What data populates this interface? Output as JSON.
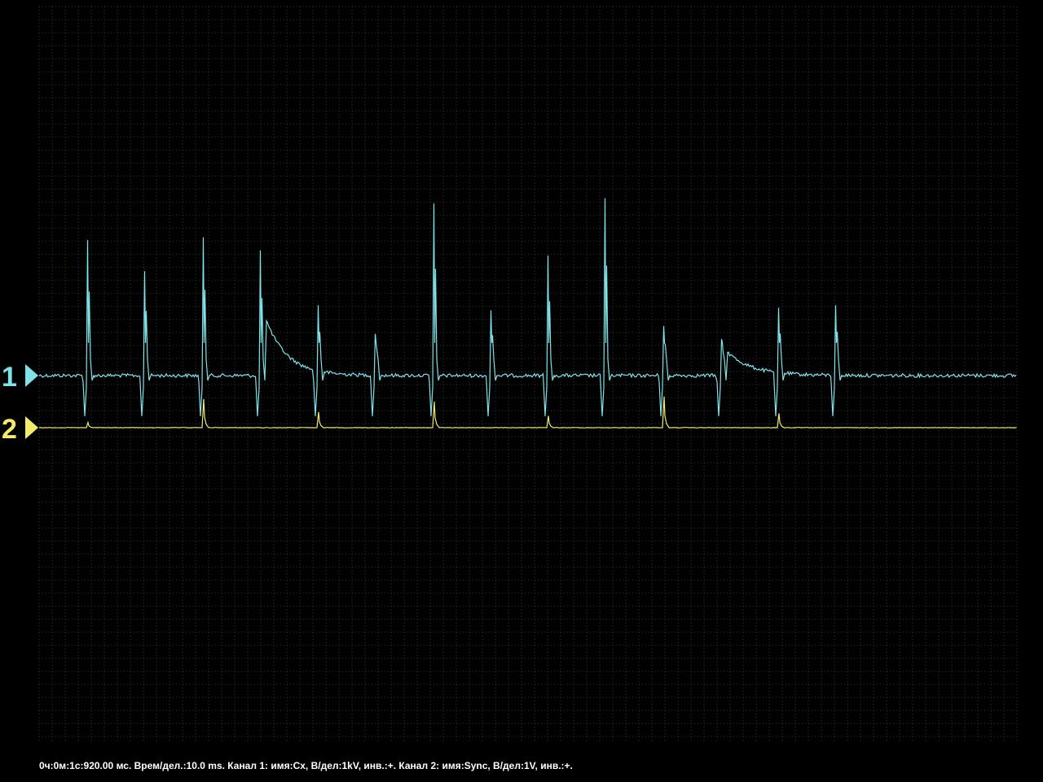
{
  "chart_data": {
    "type": "line",
    "title": "",
    "grid": true,
    "x_unit": "ms",
    "x_range": [
      0,
      120
    ],
    "time_per_div_ms": 10,
    "series": [
      {
        "name": "Cx",
        "marker_label": "1",
        "color": "#7fe3ea",
        "volts_per_div": "1kV",
        "baseline_div": 0,
        "pulses": [
          {
            "t_ms": 6.0,
            "peak_div": 5.2,
            "decay": "none"
          },
          {
            "t_ms": 13.0,
            "peak_div": 4.0,
            "decay": "none"
          },
          {
            "t_ms": 20.2,
            "peak_div": 5.3,
            "decay": "none"
          },
          {
            "t_ms": 27.2,
            "peak_div": 4.8,
            "decay": "long"
          },
          {
            "t_ms": 34.3,
            "peak_div": 2.7,
            "decay": "none"
          },
          {
            "t_ms": 41.3,
            "peak_div": 1.6,
            "decay": "none"
          },
          {
            "t_ms": 48.5,
            "peak_div": 6.6,
            "decay": "none"
          },
          {
            "t_ms": 55.5,
            "peak_div": 2.5,
            "decay": "none"
          },
          {
            "t_ms": 62.5,
            "peak_div": 4.6,
            "decay": "none"
          },
          {
            "t_ms": 69.5,
            "peak_div": 6.8,
            "decay": "none"
          },
          {
            "t_ms": 76.7,
            "peak_div": 1.9,
            "decay": "none"
          },
          {
            "t_ms": 83.8,
            "peak_div": 1.4,
            "decay": "medium"
          },
          {
            "t_ms": 90.8,
            "peak_div": 2.6,
            "decay": "none"
          },
          {
            "t_ms": 97.8,
            "peak_div": 2.7,
            "decay": "none"
          }
        ]
      },
      {
        "name": "Sync",
        "marker_label": "2",
        "color": "#f2ec6a",
        "volts_per_div": "1V",
        "baseline_div": -2,
        "pulses": [
          {
            "t_ms": 6.0,
            "peak_div": 0.2
          },
          {
            "t_ms": 20.2,
            "peak_div": 1.1
          },
          {
            "t_ms": 34.3,
            "peak_div": 0.6
          },
          {
            "t_ms": 48.5,
            "peak_div": 1.0
          },
          {
            "t_ms": 62.5,
            "peak_div": 0.45
          },
          {
            "t_ms": 76.7,
            "peak_div": 1.2
          },
          {
            "t_ms": 90.8,
            "peak_div": 0.55
          }
        ]
      }
    ]
  },
  "status_text": "0ч:0м:1с:920.00 мс. Врем/дел.:10.0 ms. Канал 1: имя:Cx, В/дел:1kV, инв.:+. Канал 2: имя:Sync, В/дел:1V, инв.:+."
}
